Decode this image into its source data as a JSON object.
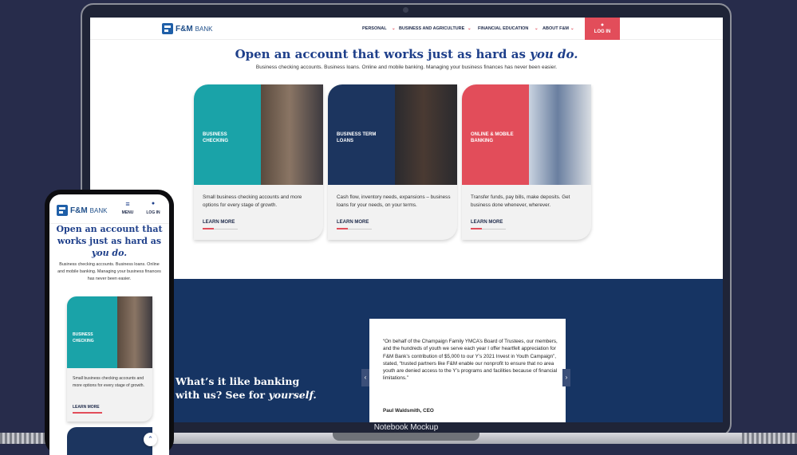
{
  "mockup_label": "Notebook Mockup",
  "logo": {
    "fm": "F&M",
    "bank": "BANK"
  },
  "nav": {
    "items": [
      "PERSONAL",
      "BUSINESS AND AGRICULTURE",
      "FINANCIAL EDUCATION",
      "ABOUT F&M"
    ],
    "login": "LOG IN"
  },
  "hero": {
    "title_start": "Open an account that works just as hard as ",
    "title_emphasis": "you do.",
    "subtitle": "Business checking accounts. Business loans. Online and mobile banking. Managing your business finances has never been easier."
  },
  "cards": [
    {
      "title_line1": "BUSINESS",
      "title_line2": "CHECKING",
      "text": "Small business checking accounts and more options for every stage of growth.",
      "link": "LEARN MORE",
      "color": "#1aa3a8"
    },
    {
      "title_line1": "BUSINESS TERM",
      "title_line2": "LOANS",
      "text": "Cash flow, inventory needs, expansions – business loans for your needs, on your terms.",
      "link": "LEARN MORE",
      "color": "#1c355f"
    },
    {
      "title_line1": "ONLINE & MOBILE",
      "title_line2": "BANKING",
      "text": "Transfer funds, pay bills, make deposits. Get business done whenever, wherever.",
      "link": "LEARN MORE",
      "color": "#e24d5a"
    }
  ],
  "testimonial_section": {
    "title_line1": "What’s it like banking",
    "title_line2_start": "with us? See for ",
    "title_emphasis": "yourself.",
    "quote": "“On behalf of the Champaign Family YMCA’s Board of Trustees, our members, and the hundreds of youth we serve each year I offer heartfelt appreciation for F&M Bank’s contribution of $5,000 to our Y’s 2021 Invest in Youth Campaign”, stated, “trusted partners like F&M enable our nonprofit to ensure that no area youth are denied access to the Y’s programs and facilities because of financial limitations.”",
    "author": "Paul Waldsmith, CEO"
  },
  "mobile": {
    "menu": "MENU",
    "login": "LOG IN",
    "title_start": "Open an account that works just as hard as ",
    "title_emphasis": "you do.",
    "subtitle": "Business checking accounts. Business loans. Online and mobile banking. Managing your business finances has never been easier.",
    "card_title_line1": "BUSINESS",
    "card_title_line2": "CHECKING",
    "card_text": "Small business checking accounts and more options for every stage of growth.",
    "card_link": "LEARN MORE"
  },
  "colors": {
    "brand_blue": "#1e3f8a",
    "accent_red": "#e24d5a",
    "teal": "#1aa3a8",
    "navy": "#163463"
  }
}
